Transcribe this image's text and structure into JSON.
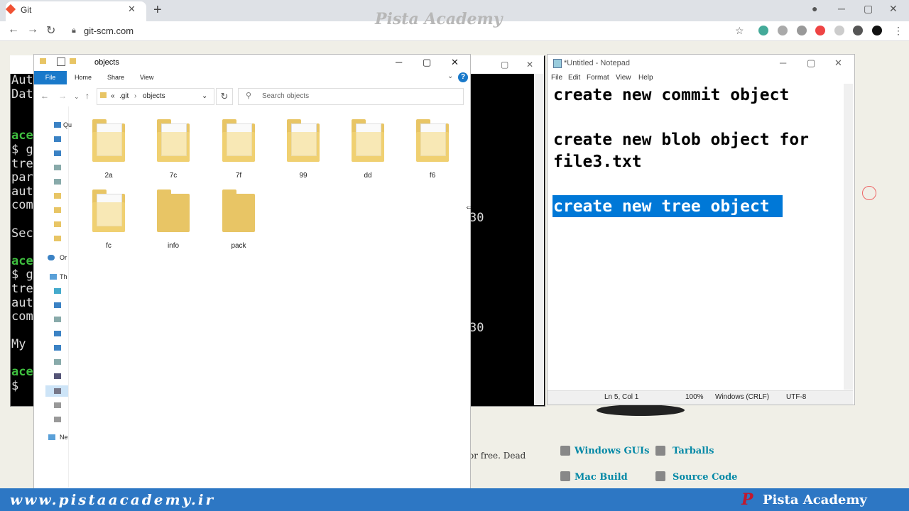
{
  "browser": {
    "tab_title": "Git",
    "url": "git-scm.com",
    "watermark": "Pista Academy"
  },
  "terminal": {
    "lines": [
      "Aut",
      "Dat",
      "",
      "",
      "ace",
      "$ g",
      "tre",
      "par",
      "aut",
      "com",
      "",
      "Sec",
      "",
      "ace",
      "$ g",
      "tre",
      "aut",
      "com",
      "",
      "My",
      "",
      "ace",
      "$ "
    ],
    "num1": "30",
    "num2": "30"
  },
  "explorer": {
    "title": "objects",
    "ribbon": {
      "file": "File",
      "home": "Home",
      "share": "Share",
      "view": "View"
    },
    "breadcrumb": [
      ".git",
      "objects"
    ],
    "search_placeholder": "Search objects",
    "nav_items": [
      "Qu",
      "Or",
      "Th",
      "Ne"
    ],
    "folders": [
      "2a",
      "7c",
      "7f",
      "99",
      "dd",
      "f6",
      "fc",
      "info",
      "pack"
    ]
  },
  "notepad": {
    "title": "*Untitled - Notepad",
    "menu": [
      "File",
      "Edit",
      "Format",
      "View",
      "Help"
    ],
    "lines": [
      "create new commit object",
      "",
      "create new blob object for",
      "file3.txt",
      "",
      "create new tree object"
    ],
    "selected_line": "create new tree object",
    "status": {
      "position": "Ln 5, Col 1",
      "zoom": "100%",
      "eol": "Windows (CRLF)",
      "encoding": "UTF-8"
    }
  },
  "webpage": {
    "links": [
      "Windows GUIs",
      "Tarballs",
      "Mac Build",
      "Source Code"
    ],
    "free_text": "or free. Dead"
  },
  "banner": {
    "url": "www.pistaacademy.ir",
    "name": "Pista Academy",
    "logo": "P"
  },
  "colors": {
    "selection": "#0078d7",
    "banner": "#2d77c4",
    "explorer_file_tab": "#1979ca"
  }
}
